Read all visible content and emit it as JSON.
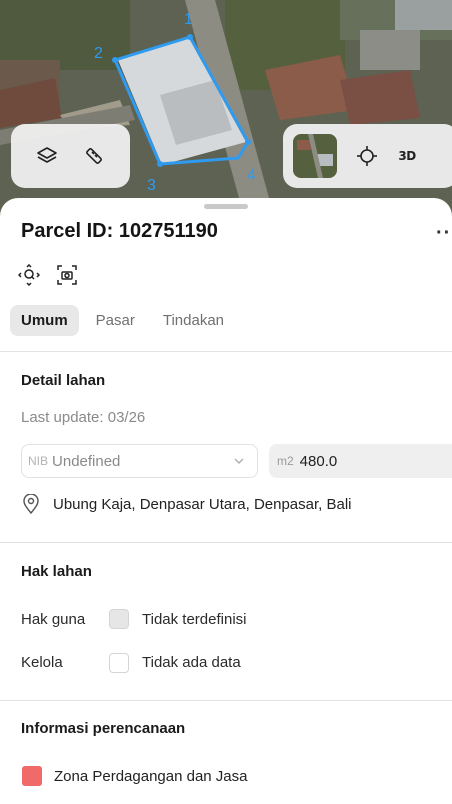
{
  "colors": {
    "parcel_outline": "#2f9bf0",
    "zone_swatch": "#f06a6a",
    "active_tab_bg": "#e8e8e8"
  },
  "map": {
    "parcel_vertices": [
      "1",
      "2",
      "3",
      "4"
    ],
    "toolbar_left": {
      "icons": [
        "layers-icon",
        "measure-icon"
      ]
    },
    "toolbar_right": {
      "icons": [
        "satellite-thumbnail",
        "locate-icon"
      ],
      "label_3d": "3D"
    }
  },
  "sheet": {
    "title": "Parcel ID: 102751190",
    "more_label": "···",
    "quick_icons": [
      "zoom-to-parcel-icon",
      "screenshot-icon"
    ],
    "tabs": [
      {
        "label": "Umum",
        "active": true
      },
      {
        "label": "Pasar",
        "active": false
      },
      {
        "label": "Tindakan",
        "active": false
      }
    ],
    "detail": {
      "heading": "Detail lahan",
      "last_update": "Last update: 03/26",
      "nib_prefix": "NIB",
      "nib_value": "Undefined",
      "area_unit": "m2",
      "area_value": "480.0",
      "location": "Ubung Kaja, Denpasar Utara, Denpasar, Bali"
    },
    "rights": {
      "heading": "Hak lahan",
      "rows": [
        {
          "label": "Hak guna",
          "value": "Tidak terdefinisi",
          "checked": true
        },
        {
          "label": "Kelola",
          "value": "Tidak ada data",
          "checked": false
        }
      ]
    },
    "planning": {
      "heading": "Informasi perencanaan",
      "zone": "Zona Perdagangan dan Jasa"
    }
  }
}
